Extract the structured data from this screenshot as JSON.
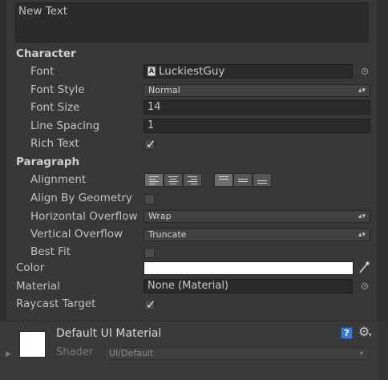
{
  "text_value": "New Text",
  "character": {
    "header": "Character",
    "font_label": "Font",
    "font_value": "LuckiestGuy",
    "font_style_label": "Font Style",
    "font_style_value": "Normal",
    "font_size_label": "Font Size",
    "font_size_value": "14",
    "line_spacing_label": "Line Spacing",
    "line_spacing_value": "1",
    "rich_text_label": "Rich Text",
    "rich_text_checked": true
  },
  "paragraph": {
    "header": "Paragraph",
    "alignment_label": "Alignment",
    "horizontal_alignment": [
      "left",
      "center",
      "right"
    ],
    "vertical_alignment": [
      "top",
      "middle",
      "bottom"
    ],
    "align_by_geometry_label": "Align By Geometry",
    "align_by_geometry_checked": false,
    "horizontal_overflow_label": "Horizontal Overflow",
    "horizontal_overflow_value": "Wrap",
    "vertical_overflow_label": "Vertical Overflow",
    "vertical_overflow_value": "Truncate",
    "best_fit_label": "Best Fit",
    "best_fit_checked": false
  },
  "color": {
    "label": "Color",
    "value": "#FFFFFF"
  },
  "material": {
    "label": "Material",
    "value": "None (Material)"
  },
  "raycast": {
    "label": "Raycast Target",
    "checked": true
  },
  "material_preview": {
    "title": "Default UI Material",
    "shader_label": "Shader",
    "shader_value": "UI/Default"
  },
  "icons": {
    "font_asset": "font-asset-icon",
    "object_picker": "object-picker-icon",
    "dropdown": "dropdown-arrow-icon",
    "eyedropper": "eyedropper-icon",
    "help": "help-icon",
    "gear": "gear-icon",
    "foldout": "foldout-arrow-icon"
  }
}
